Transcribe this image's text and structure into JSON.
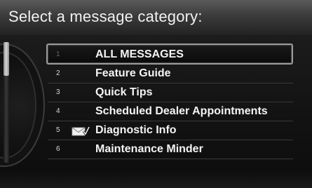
{
  "header": {
    "title": "Select a message category:"
  },
  "menu": {
    "items": [
      {
        "number": "1",
        "label": "ALL MESSAGES",
        "selected": true
      },
      {
        "number": "2",
        "label": "Feature Guide"
      },
      {
        "number": "3",
        "label": "Quick Tips"
      },
      {
        "number": "4",
        "label": "Scheduled Dealer Appointments"
      },
      {
        "number": "5",
        "label": "Diagnostic Info",
        "icon": "mail-check-icon"
      },
      {
        "number": "6",
        "label": "Maintenance Minder"
      }
    ]
  },
  "colors": {
    "header_bg": "#3b3b3b",
    "text": "#f4f4f4",
    "divider": "#3a3a3a",
    "selection_border": "#9a9a9a"
  }
}
